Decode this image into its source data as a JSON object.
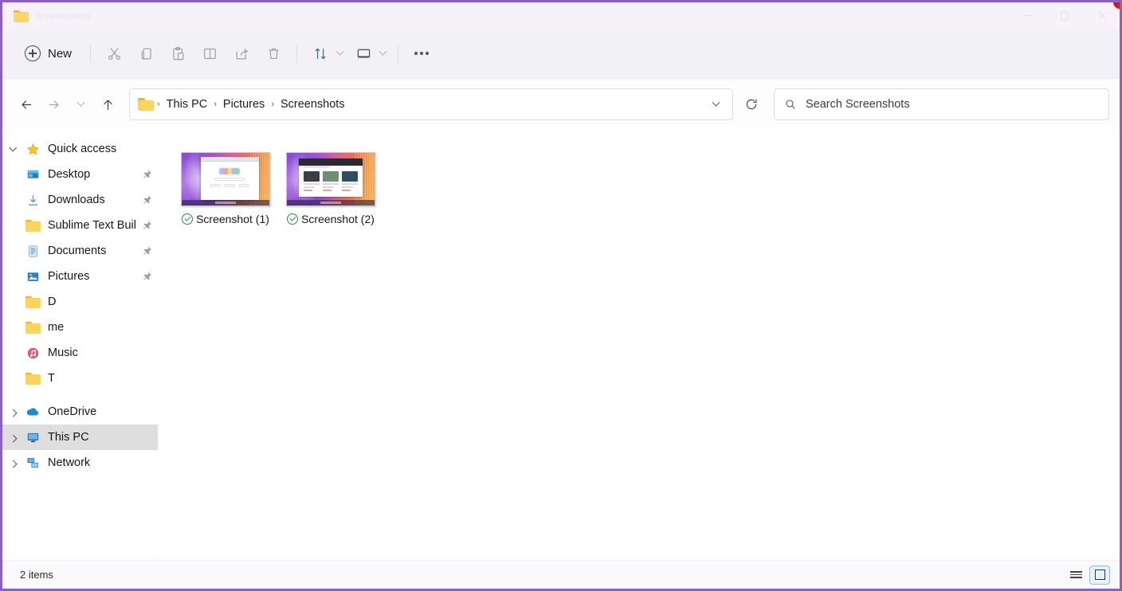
{
  "window": {
    "title": "Screenshots",
    "controls": {
      "minimize": "Minimize",
      "maximize": "Maximize",
      "close": "Close"
    },
    "accent_border": "#8a5fc8",
    "titlebar_bg": "#f6f2f8",
    "commandbar_bg": "#f2f1f6"
  },
  "toolbar": {
    "new_label": "New",
    "new_icon": "plus-circle-icon",
    "items": [
      {
        "name": "cut",
        "icon": "scissors-icon",
        "label": "Cut"
      },
      {
        "name": "copy",
        "icon": "copy-icon",
        "label": "Copy"
      },
      {
        "name": "paste",
        "icon": "paste-icon",
        "label": "Paste"
      },
      {
        "name": "rename",
        "icon": "rename-icon",
        "label": "Rename"
      },
      {
        "name": "share",
        "icon": "share-icon",
        "label": "Share"
      },
      {
        "name": "delete",
        "icon": "trash-icon",
        "label": "Delete"
      }
    ],
    "sort": {
      "label": "Sort",
      "icon": "sort-arrows-icon",
      "chevron": "chevron-down-icon"
    },
    "view": {
      "label": "View",
      "icon": "layout-icon",
      "chevron": "chevron-down-icon"
    },
    "more": {
      "label": "See more",
      "icon": "ellipsis-icon"
    }
  },
  "navbar": {
    "back": "Back",
    "forward": "Forward",
    "recent": "Recent locations",
    "up": "Up",
    "refresh": "Refresh",
    "history_chevron": "Previous locations"
  },
  "breadcrumb": {
    "folder_icon": "folder-icon",
    "separator": "›",
    "items": [
      "This PC",
      "Pictures",
      "Screenshots"
    ]
  },
  "search": {
    "placeholder": "Search Screenshots",
    "value": "",
    "icon": "search-icon"
  },
  "sidebar": {
    "groups": [
      {
        "name": "quick-access",
        "label": "Quick access",
        "icon": "star-icon",
        "expanded": true,
        "twisty": "chevron-down-icon",
        "items": [
          {
            "label": "Desktop",
            "icon": "desktop-icon",
            "pinned": true
          },
          {
            "label": "Downloads",
            "icon": "download-icon",
            "pinned": true
          },
          {
            "label": "Sublime Text Buil",
            "icon": "folder-icon",
            "pinned": true
          },
          {
            "label": "Documents",
            "icon": "documents-icon",
            "pinned": true
          },
          {
            "label": "Pictures",
            "icon": "pictures-icon",
            "pinned": true
          },
          {
            "label": "D",
            "icon": "folder-icon",
            "pinned": false
          },
          {
            "label": "me",
            "icon": "folder-icon",
            "pinned": false
          },
          {
            "label": "Music",
            "icon": "music-icon",
            "pinned": false
          },
          {
            "label": "T",
            "icon": "folder-icon",
            "pinned": false
          }
        ]
      }
    ],
    "roots": [
      {
        "label": "OneDrive",
        "icon": "cloud-icon",
        "twisty": "chevron-right-icon",
        "selected": false
      },
      {
        "label": "This PC",
        "icon": "pc-icon",
        "twisty": "chevron-right-icon",
        "selected": true
      },
      {
        "label": "Network",
        "icon": "network-icon",
        "twisty": "chevron-right-icon",
        "selected": false
      }
    ]
  },
  "files": [
    {
      "name": "Screenshot (1)",
      "badge": "cloud-synced-check",
      "thumb": "desktop-google-browser"
    },
    {
      "name": "Screenshot (2)",
      "badge": "cloud-synced-check",
      "thumb": "desktop-news-browser"
    }
  ],
  "statusbar": {
    "count_text": "2 items",
    "views": [
      {
        "name": "details-view",
        "icon": "list-lines-icon",
        "selected": false
      },
      {
        "name": "large-icons-view",
        "icon": "square-icon",
        "selected": true
      }
    ]
  }
}
